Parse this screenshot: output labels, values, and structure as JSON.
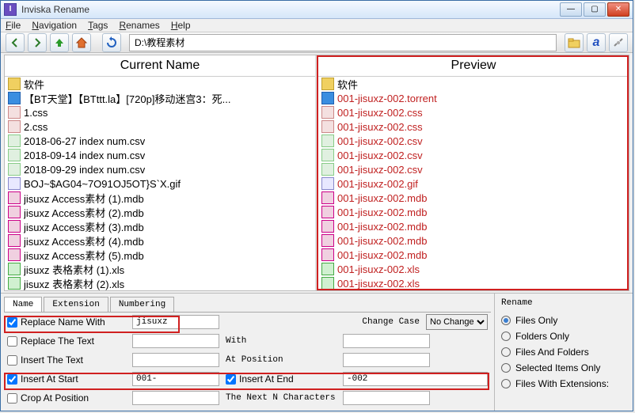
{
  "window": {
    "title": "Inviska Rename"
  },
  "menu": {
    "file": "File",
    "navigation": "Navigation",
    "tags": "Tags",
    "renames": "Renames",
    "help": "Help"
  },
  "toolbar": {
    "path": "D:\\教程素材"
  },
  "panels": {
    "left_title": "Current Name",
    "right_title": "Preview"
  },
  "current_names": [
    {
      "icon": "folder",
      "name": "软件"
    },
    {
      "icon": "bt",
      "name": "【BT天堂】【BTttt.la】[720p]移动迷宫3：死..."
    },
    {
      "icon": "css",
      "name": "1.css"
    },
    {
      "icon": "css",
      "name": "2.css"
    },
    {
      "icon": "csv",
      "name": "2018-06-27 index num.csv"
    },
    {
      "icon": "csv",
      "name": "2018-09-14 index num.csv"
    },
    {
      "icon": "csv",
      "name": "2018-09-29 index num.csv"
    },
    {
      "icon": "gif",
      "name": "BOJ~$AG04~7O91OJ5OT}S`X.gif"
    },
    {
      "icon": "mdb",
      "name": "jisuxz Access素材 (1).mdb"
    },
    {
      "icon": "mdb",
      "name": "jisuxz Access素材 (2).mdb"
    },
    {
      "icon": "mdb",
      "name": "jisuxz Access素材 (3).mdb"
    },
    {
      "icon": "mdb",
      "name": "jisuxz Access素材 (4).mdb"
    },
    {
      "icon": "mdb",
      "name": "jisuxz Access素材 (5).mdb"
    },
    {
      "icon": "xls",
      "name": "jisuxz 表格素材 (1).xls"
    },
    {
      "icon": "xls",
      "name": "jisuxz 表格素材 (2).xls"
    }
  ],
  "preview_names": [
    {
      "icon": "folder",
      "name": "软件",
      "plain": true
    },
    {
      "icon": "bt",
      "name": "001-jisuxz-002.torrent"
    },
    {
      "icon": "css",
      "name": "001-jisuxz-002.css"
    },
    {
      "icon": "css",
      "name": "001-jisuxz-002.css"
    },
    {
      "icon": "csv",
      "name": "001-jisuxz-002.csv"
    },
    {
      "icon": "csv",
      "name": "001-jisuxz-002.csv"
    },
    {
      "icon": "csv",
      "name": "001-jisuxz-002.csv"
    },
    {
      "icon": "gif",
      "name": "001-jisuxz-002.gif"
    },
    {
      "icon": "mdb",
      "name": "001-jisuxz-002.mdb"
    },
    {
      "icon": "mdb",
      "name": "001-jisuxz-002.mdb"
    },
    {
      "icon": "mdb",
      "name": "001-jisuxz-002.mdb"
    },
    {
      "icon": "mdb",
      "name": "001-jisuxz-002.mdb"
    },
    {
      "icon": "mdb",
      "name": "001-jisuxz-002.mdb"
    },
    {
      "icon": "xls",
      "name": "001-jisuxz-002.xls"
    },
    {
      "icon": "xls",
      "name": "001-jisuxz-002.xls"
    }
  ],
  "tabs": {
    "name": "Name",
    "extension": "Extension",
    "numbering": "Numbering"
  },
  "form": {
    "replace_name_with": "Replace Name With",
    "replace_name_with_value": "jisuxz",
    "replace_the_text": "Replace The Text",
    "with": "With",
    "insert_the_text": "Insert The Text",
    "at_position": "At Position",
    "insert_at_start": "Insert At Start",
    "insert_at_start_value": "001-",
    "insert_at_end": "Insert At End",
    "insert_at_end_value": "-002",
    "crop_at_position": "Crop At Position",
    "the_next_n": "The Next N Characters",
    "change_case": "Change Case",
    "change_case_value": "No Change"
  },
  "rename_group": {
    "title": "Rename",
    "files_only": "Files Only",
    "folders_only": "Folders Only",
    "files_and_folders": "Files And Folders",
    "selected_items_only": "Selected Items Only",
    "files_with_ext": "Files With Extensions:"
  }
}
